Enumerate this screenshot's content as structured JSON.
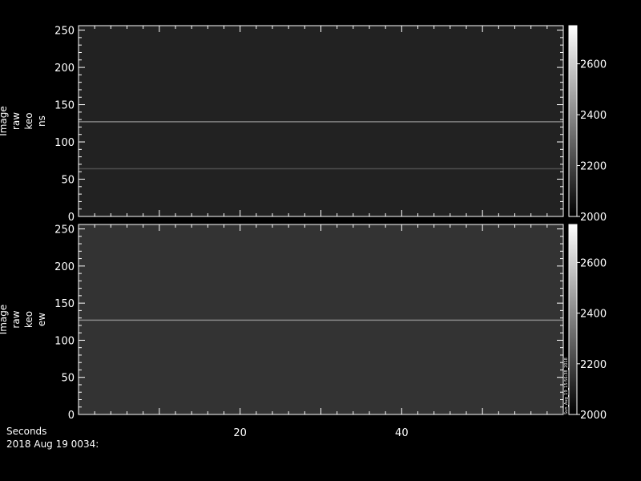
{
  "figure": {
    "xaxis_label": "Seconds",
    "date_label": "2018 Aug 19 0034:"
  },
  "colorbar_side_text": "Sun_Aug_19_15:56:38_2018",
  "chart_data": [
    {
      "type": "heatmap",
      "title": "",
      "ylabel": "Image raw keo ns",
      "ylabel_lines": [
        "Image",
        "raw",
        "keo",
        "ns"
      ],
      "xlabel": "Seconds",
      "xlim": [
        0,
        60
      ],
      "ylim": [
        0,
        256
      ],
      "x_ticks": [
        20,
        40
      ],
      "y_ticks": [
        0,
        50,
        100,
        150,
        200,
        250
      ],
      "colorbar": {
        "range": [
          2000,
          2750
        ],
        "ticks": [
          2000,
          2200,
          2400,
          2600
        ]
      },
      "grid": false,
      "background_level": 2100,
      "bright_rows": [
        {
          "y": 127,
          "level": 2380
        },
        {
          "y": 64,
          "level": 2230
        }
      ]
    },
    {
      "type": "heatmap",
      "title": "",
      "ylabel": "Image raw keo ew",
      "ylabel_lines": [
        "Image",
        "raw",
        "keo",
        "ew"
      ],
      "xlabel": "Seconds",
      "xlim": [
        0,
        60
      ],
      "ylim": [
        0,
        256
      ],
      "x_ticks": [
        20,
        40
      ],
      "y_ticks": [
        0,
        50,
        100,
        150,
        200,
        250
      ],
      "colorbar": {
        "range": [
          2000,
          2750
        ],
        "ticks": [
          2000,
          2200,
          2400,
          2600
        ]
      },
      "grid": false,
      "background_level": 2150,
      "bright_rows": [
        {
          "y": 127,
          "level": 2400
        }
      ]
    }
  ]
}
